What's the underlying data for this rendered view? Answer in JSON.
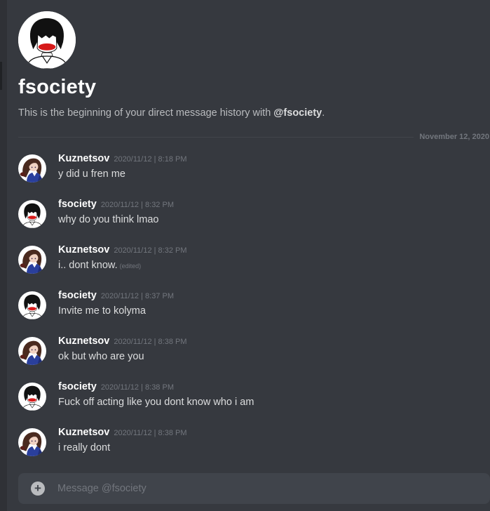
{
  "intro": {
    "title": "fsociety",
    "desc_prefix": "This is the beginning of your direct message history with ",
    "mention": "@fsociety",
    "desc_suffix": "."
  },
  "divider": {
    "date": "November 12, 2020"
  },
  "messages": [
    {
      "author": "Kuznetsov",
      "time": "2020/11/12 | 8:18 PM",
      "text": "y did u fren me",
      "avatar": "kuznetsov-avatar"
    },
    {
      "author": "fsociety",
      "time": "2020/11/12 | 8:32 PM",
      "text": "why do you think lmao",
      "avatar": "fsociety-avatar"
    },
    {
      "author": "Kuznetsov",
      "time": "2020/11/12 | 8:32 PM",
      "text": "i.. dont know.",
      "edited": "(edited)",
      "avatar": "kuznetsov-avatar"
    },
    {
      "author": "fsociety",
      "time": "2020/11/12 | 8:37 PM",
      "text": "Invite me to kolyma",
      "avatar": "fsociety-avatar"
    },
    {
      "author": "Kuznetsov",
      "time": "2020/11/12 | 8:38 PM",
      "text": "ok but who are you",
      "avatar": "kuznetsov-avatar"
    },
    {
      "author": "fsociety",
      "time": "2020/11/12 | 8:38 PM",
      "text": "Fuck off acting like you dont know who i am",
      "avatar": "fsociety-avatar"
    },
    {
      "author": "Kuznetsov",
      "time": "2020/11/12 | 8:38 PM",
      "text": "i really dont",
      "avatar": "kuznetsov-avatar"
    }
  ],
  "composer": {
    "placeholder": "Message @fsociety",
    "add_icon": "plus-circle-icon"
  },
  "colors": {
    "background": "#36393f",
    "sidebar": "#2f3136",
    "input_bg": "#40444b",
    "username": "#ffffff",
    "text": "#dcddde",
    "muted": "#72767d"
  }
}
